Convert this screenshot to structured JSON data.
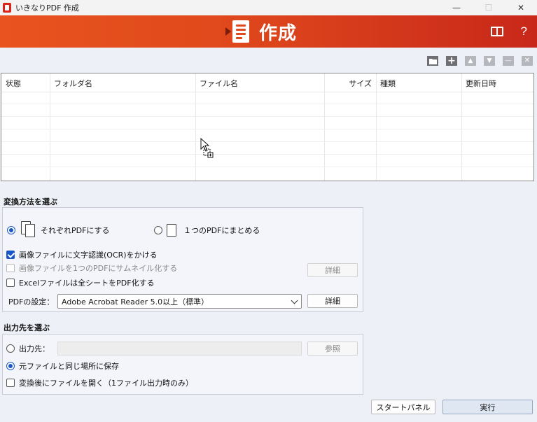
{
  "window": {
    "title": "いきなりPDF 作成",
    "minimize": "—",
    "maximize": "☐",
    "close": "✕"
  },
  "header": {
    "title": "作成",
    "manual_icon": "book-icon",
    "help_label": "?"
  },
  "toolbar": {
    "buttons": [
      {
        "name": "folder-icon",
        "glyph": "▬",
        "enabled": true
      },
      {
        "name": "add-icon",
        "glyph": "+",
        "enabled": true
      },
      {
        "name": "move-up-icon",
        "glyph": "▲",
        "enabled": false
      },
      {
        "name": "move-down-icon",
        "glyph": "▼",
        "enabled": false
      },
      {
        "name": "remove-icon",
        "glyph": "—",
        "enabled": false
      },
      {
        "name": "clear-icon",
        "glyph": "✕",
        "enabled": false
      }
    ]
  },
  "filelist": {
    "columns": [
      "状態",
      "フォルダ名",
      "ファイル名",
      "サイズ",
      "種類",
      "更新日時"
    ],
    "rows": []
  },
  "conversion": {
    "section_title": "変換方法を選ぶ",
    "radio_each": "それぞれPDFにする",
    "radio_combine": "１つのPDFにまとめる",
    "ocr_label": "画像ファイルに文字認識(OCR)をかける",
    "thumbnail_label": "画像ファイルを1つのPDFにサムネイル化する",
    "thumbnail_detail": "詳細",
    "excel_label": "Excelファイルは全シートをPDF化する",
    "pdf_settings_label": "PDFの設定：",
    "pdf_settings_value": "Adobe Acrobat Reader 5.0以上（標準）",
    "pdf_settings_detail": "詳細"
  },
  "output": {
    "section_title": "出力先を選ぶ",
    "radio_dest": "出力先：",
    "dest_value": "",
    "browse": "参照",
    "radio_same": "元ファイルと同じ場所に保存",
    "open_after": "変換後にファイルを開く（1ファイル出力時のみ）"
  },
  "footer": {
    "start_panel": "スタートパネル",
    "execute": "実行"
  }
}
